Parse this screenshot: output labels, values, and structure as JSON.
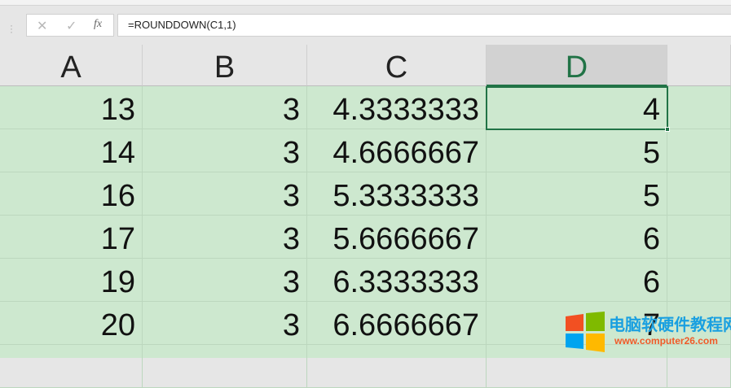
{
  "formula_bar": {
    "cancel_icon": "✕",
    "enter_icon": "✓",
    "fx_label": "fx",
    "formula": "=ROUNDDOWN(C1,1)"
  },
  "columns": [
    "A",
    "B",
    "C",
    "D"
  ],
  "selected_column": "D",
  "rows": [
    [
      "13",
      "3",
      "4.3333333",
      "4"
    ],
    [
      "14",
      "3",
      "4.6666667",
      "5"
    ],
    [
      "16",
      "3",
      "5.3333333",
      "5"
    ],
    [
      "17",
      "3",
      "5.6666667",
      "6"
    ],
    [
      "19",
      "3",
      "6.3333333",
      "6"
    ],
    [
      "20",
      "3",
      "6.6666667",
      "7"
    ]
  ],
  "watermark": {
    "title": "电脑软硬件教程网",
    "url": "www.computer26.com"
  },
  "colors": {
    "selection": "#217346",
    "cell_bg": "#cde8cf"
  }
}
